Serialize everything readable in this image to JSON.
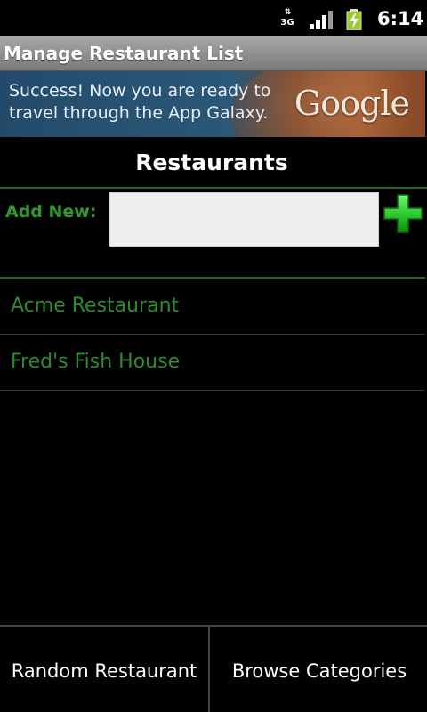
{
  "status_bar": {
    "network_label": "3G",
    "time": "6:14",
    "icons": [
      "data-arrows-icon",
      "signal-icon",
      "battery-charging-icon"
    ]
  },
  "title_bar": {
    "title": "Manage Restaurant List"
  },
  "ad_banner": {
    "text": "Success! Now you are ready to travel through the App Galaxy.",
    "logo": "Google"
  },
  "header": {
    "title": "Restaurants"
  },
  "add_new": {
    "label": "Add New:",
    "value": "",
    "placeholder": "",
    "button_icon": "plus-icon",
    "button_color": "#2ecc2e"
  },
  "restaurants": [
    {
      "name": "Acme Restaurant"
    },
    {
      "name": "Fred's Fish House"
    }
  ],
  "bottom_buttons": {
    "random_label": "Random Restaurant",
    "browse_label": "Browse Categories"
  },
  "colors": {
    "accent_green": "#2e8b2e",
    "divider_green": "#1f6a1f",
    "background": "#000000"
  }
}
